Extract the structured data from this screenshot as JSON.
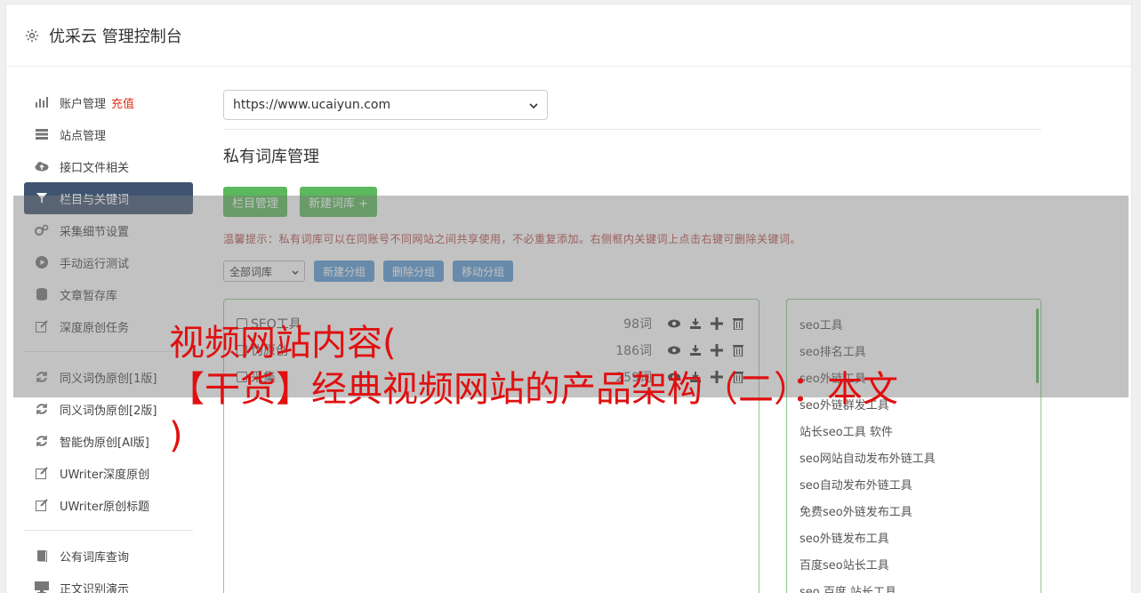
{
  "header": {
    "title": "优采云 管理控制台",
    "icon": "gear-icon"
  },
  "sidebar": {
    "items": [
      {
        "label": "账户管理",
        "badge": "充值",
        "icon": "bar-chart-icon"
      },
      {
        "label": "站点管理",
        "icon": "server-icon"
      },
      {
        "label": "接口文件相关",
        "icon": "cloud-upload-icon"
      },
      {
        "label": "栏目与关键词",
        "icon": "filter-icon",
        "active": true
      },
      {
        "label": "采集细节设置",
        "icon": "gears-icon"
      },
      {
        "label": "手动运行测试",
        "icon": "play-circle-icon"
      },
      {
        "label": "文章暂存库",
        "icon": "database-icon"
      },
      {
        "label": "深度原创任务",
        "icon": "edit-icon"
      }
    ],
    "items2": [
      {
        "label": "同义词伪原创[1版]",
        "icon": "refresh-icon"
      },
      {
        "label": "同义词伪原创[2版]",
        "icon": "refresh-icon"
      },
      {
        "label": "智能伪原创[AI版]",
        "icon": "refresh-icon"
      },
      {
        "label": "UWriter深度原创",
        "icon": "edit-icon"
      },
      {
        "label": "UWriter原创标题",
        "icon": "edit-icon"
      }
    ],
    "items3": [
      {
        "label": "公有词库查询",
        "icon": "book-icon"
      },
      {
        "label": "正文识别演示",
        "icon": "monitor-icon"
      }
    ]
  },
  "main": {
    "site_select": "https://www.ucaiyun.com",
    "section_title": "私有词库管理",
    "btn_column": "栏目管理",
    "btn_new_lib": "新建词库 +",
    "tip": "温馨提示：私有词库可以在同账号不同网站之间共享使用，不必重复添加。右侧框内关键词上点击右键可删除关键词。",
    "filter_select": "全部词库",
    "btn_new_group": "新建分组",
    "btn_del_group": "删除分组",
    "btn_move_group": "移动分组",
    "libraries": [
      {
        "name": "SEO工具",
        "count": "98词"
      },
      {
        "name": "伪原创",
        "count": "186词"
      },
      {
        "name": "采集",
        "count": "259词"
      }
    ],
    "keywords": [
      "seo工具",
      "seo排名工具",
      "seo外链工具",
      "seo外链群发工具",
      "站长seo工具 软件",
      "seo网站自动发布外链工具",
      "seo自动发布外链工具",
      "免费seo外链发布工具",
      "seo外链发布工具",
      "百度seo站长工具",
      "seo 百度 站长工具"
    ]
  },
  "overlay": {
    "line1": "视频网站内容(",
    "line2": "【干货】经典视频网站的产品架构（二）：本文",
    "line3": ")"
  }
}
